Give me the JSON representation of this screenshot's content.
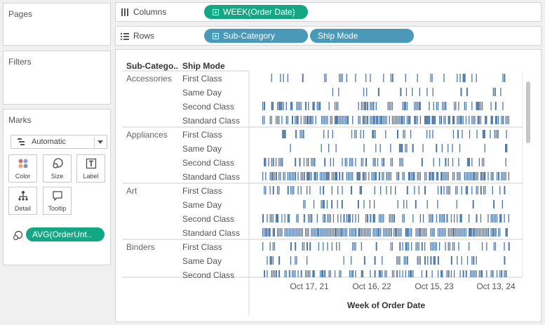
{
  "pages": {
    "title": "Pages"
  },
  "filters": {
    "title": "Filters"
  },
  "marks": {
    "title": "Marks",
    "mark_type": "Automatic",
    "buttons": [
      {
        "id": "color",
        "label": "Color",
        "icon": "color-icon"
      },
      {
        "id": "size",
        "label": "Size",
        "icon": "size-icon"
      },
      {
        "id": "label",
        "label": "Label",
        "icon": "label-icon"
      },
      {
        "id": "detail",
        "label": "Detail",
        "icon": "detail-icon"
      },
      {
        "id": "tooltip",
        "label": "Tooltip",
        "icon": "tooltip-icon"
      }
    ],
    "size_pill": "AVG(OrderUnt.."
  },
  "shelves": {
    "columns": {
      "label": "Columns",
      "pills": [
        "WEEK(Order Date)"
      ]
    },
    "rows": {
      "label": "Rows",
      "pills": [
        "Sub-Category",
        "Ship Mode"
      ]
    }
  },
  "viz": {
    "header_subcategory": "Sub-Catego..",
    "header_shipmode": "Ship Mode",
    "categories": [
      "Accessories",
      "Appliances",
      "Art",
      "Binders"
    ],
    "ship_modes": [
      "First Class",
      "Same Day",
      "Second Class",
      "Standard Class"
    ],
    "axis_ticks": [
      "Oct 17, 21",
      "Oct 16, 22",
      "Oct 15, 23",
      "Oct 13, 24"
    ],
    "axis_title": "Week of Order Date"
  },
  "colors": {
    "mark": "#4e79a7",
    "green_pill": "#13a883",
    "blue_pill": "#4b99b8"
  }
}
